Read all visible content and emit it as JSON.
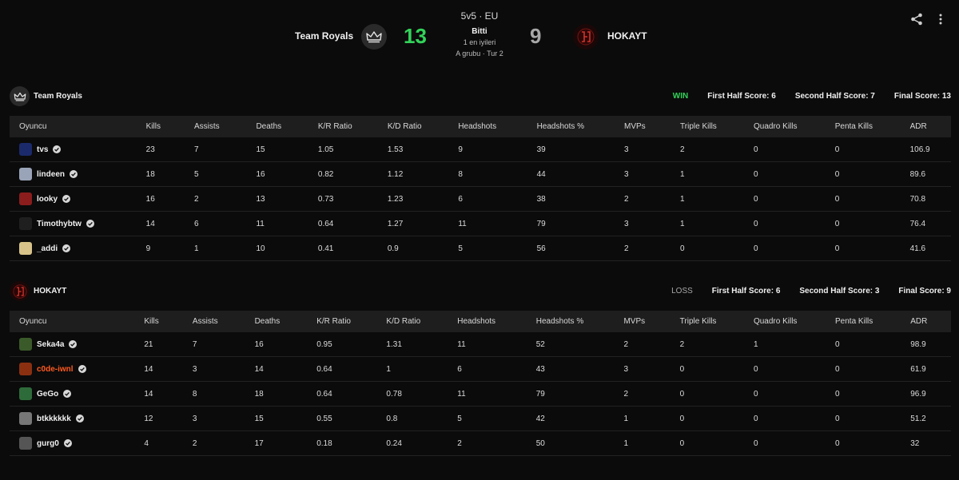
{
  "match": {
    "mode": "5v5 · EU",
    "status": "Bitti",
    "best_of": "1 en iyileri",
    "group": "A grubu · Tur 2",
    "team1_name": "Team Royals",
    "team2_name": "HOKAYT",
    "team1_score": "13",
    "team2_score": "9"
  },
  "colors": {
    "win": "#32d35a",
    "highlight_player": "#ff5a1f"
  },
  "headers": [
    "Oyuncu",
    "Kills",
    "Assists",
    "Deaths",
    "K/R Ratio",
    "K/D Ratio",
    "Headshots",
    "Headshots %",
    "MVPs",
    "Triple Kills",
    "Quadro Kills",
    "Penta Kills",
    "ADR"
  ],
  "teams": [
    {
      "name": "Team Royals",
      "result": "WIN",
      "first_half": "First Half Score: 6",
      "second_half": "Second Half Score: 7",
      "final": "Final Score: 13",
      "players": [
        {
          "name": "tvs",
          "stats": [
            "23",
            "7",
            "15",
            "1.05",
            "1.53",
            "9",
            "39",
            "3",
            "2",
            "0",
            "0",
            "106.9"
          ]
        },
        {
          "name": "lindeen",
          "stats": [
            "18",
            "5",
            "16",
            "0.82",
            "1.12",
            "8",
            "44",
            "3",
            "1",
            "0",
            "0",
            "89.6"
          ]
        },
        {
          "name": "looky",
          "stats": [
            "16",
            "2",
            "13",
            "0.73",
            "1.23",
            "6",
            "38",
            "2",
            "1",
            "0",
            "0",
            "70.8"
          ]
        },
        {
          "name": "Timothybtw",
          "stats": [
            "14",
            "6",
            "11",
            "0.64",
            "1.27",
            "11",
            "79",
            "3",
            "1",
            "0",
            "0",
            "76.4"
          ]
        },
        {
          "name": "_addi",
          "stats": [
            "9",
            "1",
            "10",
            "0.41",
            "0.9",
            "5",
            "56",
            "2",
            "0",
            "0",
            "0",
            "41.6"
          ]
        }
      ]
    },
    {
      "name": "HOKAYT",
      "result": "LOSS",
      "first_half": "First Half Score: 6",
      "second_half": "Second Half Score: 3",
      "final": "Final Score: 9",
      "players": [
        {
          "name": "Seka4a",
          "stats": [
            "21",
            "7",
            "16",
            "0.95",
            "1.31",
            "11",
            "52",
            "2",
            "2",
            "1",
            "0",
            "98.9"
          ]
        },
        {
          "name": "c0de-iwnl",
          "stats": [
            "14",
            "3",
            "14",
            "0.64",
            "1",
            "6",
            "43",
            "3",
            "0",
            "0",
            "0",
            "61.9"
          ]
        },
        {
          "name": "GeGo",
          "stats": [
            "14",
            "8",
            "18",
            "0.64",
            "0.78",
            "11",
            "79",
            "2",
            "0",
            "0",
            "0",
            "96.9"
          ]
        },
        {
          "name": "btkkkkkk",
          "stats": [
            "12",
            "3",
            "15",
            "0.55",
            "0.8",
            "5",
            "42",
            "1",
            "0",
            "0",
            "0",
            "51.2"
          ]
        },
        {
          "name": "gurg0",
          "stats": [
            "4",
            "2",
            "17",
            "0.18",
            "0.24",
            "2",
            "50",
            "1",
            "0",
            "0",
            "0",
            "32"
          ]
        }
      ]
    }
  ]
}
